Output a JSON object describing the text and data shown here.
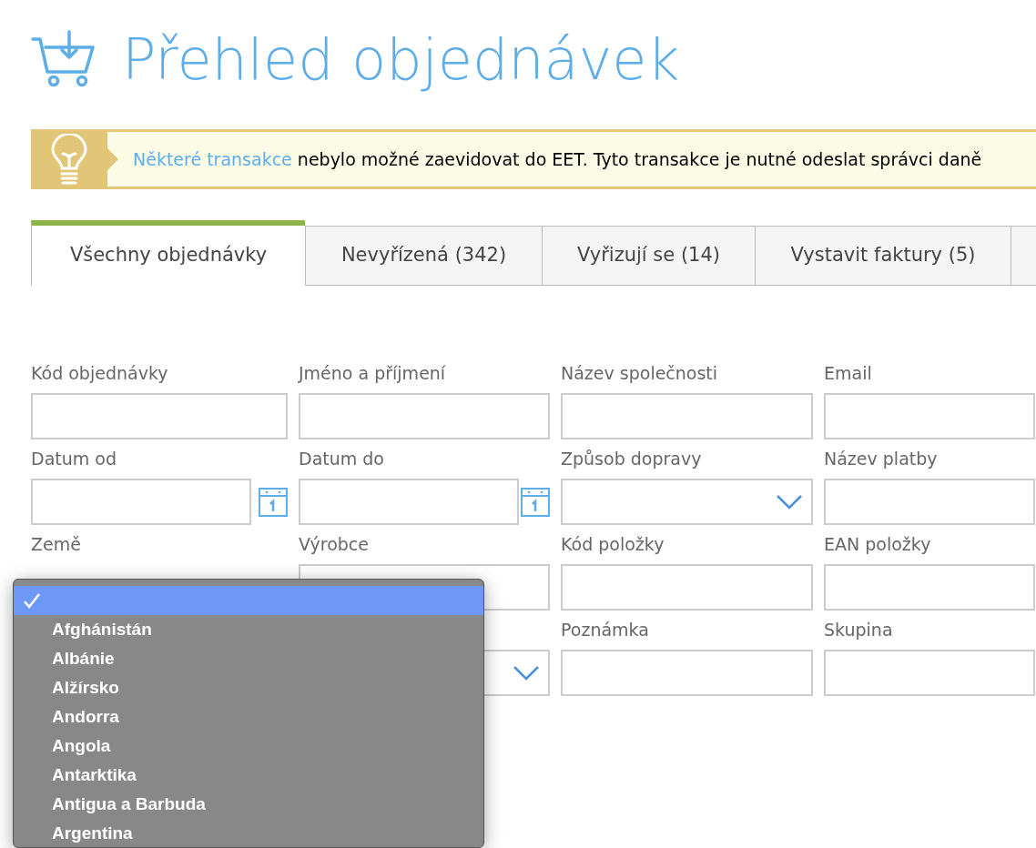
{
  "title": "Přehled objednávek",
  "notice": {
    "link": "Některé transakce",
    "text": "nebylo možné zaevidovat do EET. Tyto transakce je nutné odeslat správci daně"
  },
  "tabs": [
    {
      "label": "Všechny objednávky",
      "selected": true
    },
    {
      "label": "Nevyřízená (342)",
      "selected": false
    },
    {
      "label": "Vyřizují se (14)",
      "selected": false
    },
    {
      "label": "Vystavit faktury (5)",
      "selected": false
    },
    {
      "selected": false
    }
  ],
  "filters": [
    {
      "label": "Kód objednávky",
      "kind": "text"
    },
    {
      "label": "Jméno a příjmení",
      "kind": "text"
    },
    {
      "label": "Název společnosti",
      "kind": "text"
    },
    {
      "label": "Email",
      "kind": "text"
    },
    {
      "label": "Datum od",
      "kind": "date"
    },
    {
      "label": "Datum do",
      "kind": "date"
    },
    {
      "label": "Způsob dopravy",
      "kind": "select"
    },
    {
      "label": "Název platby",
      "kind": "text"
    },
    {
      "label": "Země",
      "kind": "covered"
    },
    {
      "label": "Výrobce",
      "kind": "text"
    },
    {
      "label": "Kód položky",
      "kind": "text"
    },
    {
      "label": "EAN položky",
      "kind": "text"
    },
    {
      "kind": "covered"
    },
    {
      "kind": "select"
    },
    {
      "label": "Poznámka",
      "kind": "text"
    },
    {
      "label": "Skupina",
      "kind": "text"
    }
  ],
  "country_dropdown": {
    "options": [
      {
        "selected": true
      },
      {
        "label": "Afghánistán",
        "selected": false
      },
      {
        "label": "Albánie",
        "selected": false
      },
      {
        "label": "Alžírsko",
        "selected": false
      },
      {
        "label": "Andorra",
        "selected": false
      },
      {
        "label": "Angola",
        "selected": false
      },
      {
        "label": "Antarktika",
        "selected": false
      },
      {
        "label": "Antigua a Barbuda",
        "selected": false
      },
      {
        "label": "Argentina",
        "selected": false
      }
    ]
  }
}
